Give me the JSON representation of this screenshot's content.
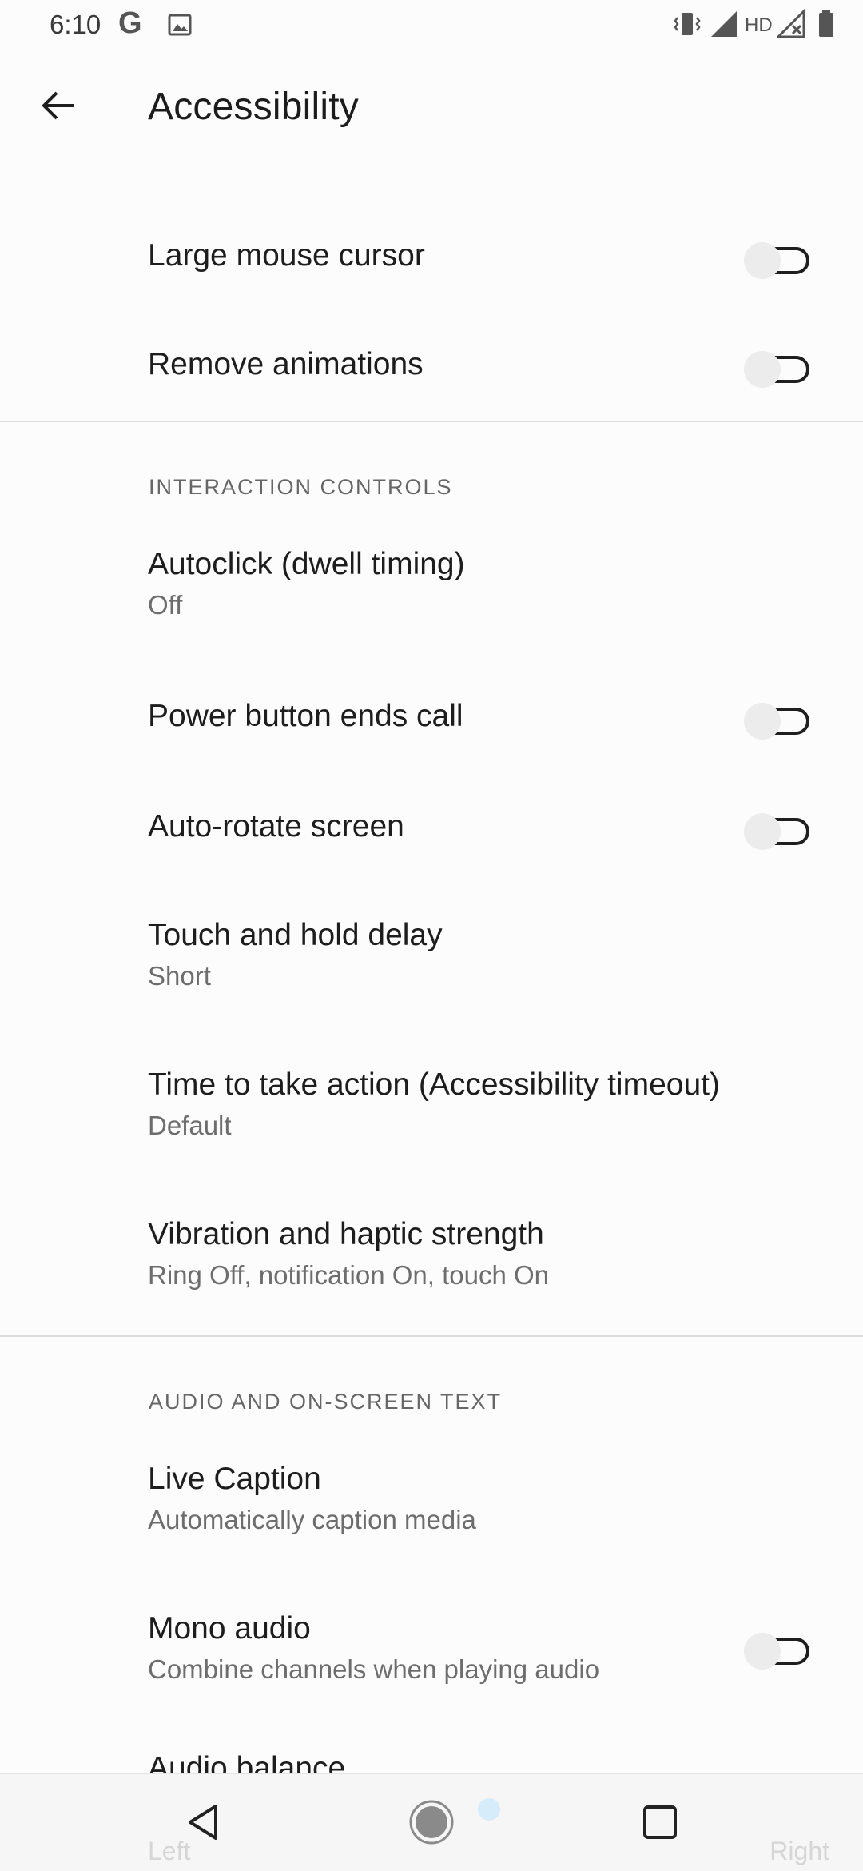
{
  "status": {
    "time": "6:10",
    "google_icon": "G",
    "network_label": "HD"
  },
  "header": {
    "title": "Accessibility",
    "back_icon": "arrow-left-icon"
  },
  "items": [
    {
      "title": "Large mouse cursor",
      "toggle": false
    },
    {
      "title": "Remove animations",
      "toggle": false
    }
  ],
  "sections": [
    {
      "header": "INTERACTION CONTROLS",
      "items": [
        {
          "title": "Autoclick (dwell timing)",
          "subtitle": "Off"
        },
        {
          "title": "Power button ends call",
          "toggle": false
        },
        {
          "title": "Auto-rotate screen",
          "toggle": false
        },
        {
          "title": "Touch and hold delay",
          "subtitle": "Short"
        },
        {
          "title": "Time to take action (Accessibility timeout)",
          "subtitle": "Default"
        },
        {
          "title": "Vibration and haptic strength",
          "subtitle": "Ring Off, notification On, touch On"
        }
      ]
    },
    {
      "header": "AUDIO AND ON-SCREEN TEXT",
      "items": [
        {
          "title": "Live Caption",
          "subtitle": "Automatically caption media"
        },
        {
          "title": "Mono audio",
          "subtitle": "Combine channels when playing audio",
          "toggle": false
        },
        {
          "title": "Audio balance",
          "slider_left": "Left",
          "slider_right": "Right"
        }
      ]
    }
  ],
  "colors": {
    "background": "#fdfcfc",
    "divider": "#dcdcdc",
    "toggle_thumb": "#ececec",
    "toggle_track": "#1f1f1f"
  }
}
